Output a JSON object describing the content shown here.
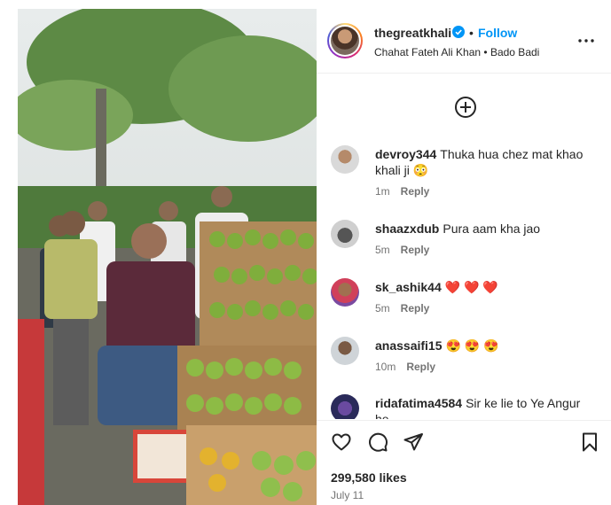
{
  "colors": {
    "accent": "#0095f6",
    "text": "#262626",
    "muted": "#737373"
  },
  "post": {
    "username": "thegreatkhali",
    "follow_label": "Follow",
    "separator": "•",
    "subtitle": "Chahat Fateh Ali Khan • Bado Badi",
    "likes": "299,580 likes",
    "date": "July 11"
  },
  "comments": [
    {
      "user": "devroy344",
      "text": "Thuka hua chez mat khao khali ji 😳",
      "time": "1m",
      "reply": "Reply"
    },
    {
      "user": "shaazxdub",
      "text": "Pura aam kha jao",
      "time": "5m",
      "reply": "Reply"
    },
    {
      "user": "sk_ashik44",
      "text": "❤️ ❤️ ❤️",
      "time": "5m",
      "reply": "Reply"
    },
    {
      "user": "anassaifi15",
      "text": "😍 😍 😍",
      "time": "10m",
      "reply": "Reply"
    },
    {
      "user": "ridafatima4584",
      "text": "Sir ke lie to Ye Angur he",
      "time": "",
      "reply": ""
    }
  ],
  "icons": {
    "more": "more-options-icon",
    "add_comment": "plus-circle-icon",
    "like": "heart-icon",
    "comment": "comment-icon",
    "share": "paper-plane-icon",
    "save": "bookmark-icon",
    "verified": "verified-badge-icon"
  }
}
